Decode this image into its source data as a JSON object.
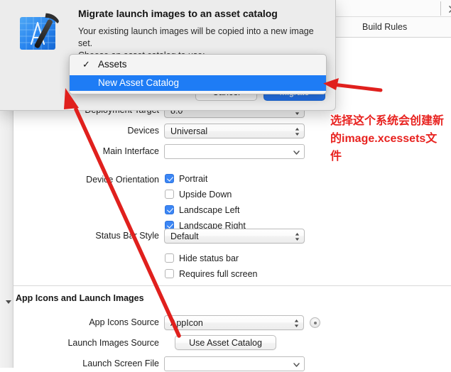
{
  "window": {
    "tabs": [
      {
        "id": "build-rules",
        "label": "Build Rules"
      }
    ],
    "chevron_icon": "chevron-right-icon"
  },
  "sheet": {
    "icon": "xcode-app-icon",
    "title": "Migrate launch images to an asset catalog",
    "body_line1": "Your existing launch images will be copied into a new image set.",
    "body_line2": "Choose an asset catalog to use:",
    "cancel_label": "Cancel",
    "migrate_label": "Migrate"
  },
  "menu": {
    "items": [
      {
        "label": "Assets",
        "checked": true,
        "selected": false
      },
      {
        "label": "New Asset Catalog",
        "checked": false,
        "selected": true
      }
    ],
    "check_glyph": "✓",
    "highlight_color": "#1e7cf5"
  },
  "form": {
    "deployment_target": {
      "label": "Deployment Target",
      "value": "8.0"
    },
    "devices": {
      "label": "Devices",
      "value": "Universal"
    },
    "main_interface": {
      "label": "Main Interface",
      "value": ""
    },
    "device_orientation": {
      "label": "Device Orientation",
      "options": [
        {
          "label": "Portrait",
          "checked": true
        },
        {
          "label": "Upside Down",
          "checked": false
        },
        {
          "label": "Landscape Left",
          "checked": true
        },
        {
          "label": "Landscape Right",
          "checked": true
        }
      ]
    },
    "status_bar_style": {
      "label": "Status Bar Style",
      "value": "Default"
    },
    "status_options": [
      {
        "label": "Hide status bar",
        "checked": false
      },
      {
        "label": "Requires full screen",
        "checked": false
      }
    ],
    "app_icons_section": {
      "header": "App Icons and Launch Images",
      "app_icons_source": {
        "label": "App Icons Source",
        "value": "AppIcon"
      },
      "launch_images_source": {
        "label": "Launch Images Source",
        "button_label": "Use Asset Catalog"
      },
      "launch_screen_file": {
        "label": "Launch Screen File",
        "value": ""
      }
    }
  },
  "annotation": {
    "text": "选择这个系统会创建新的image.xcessets文件",
    "color": "#e8221f"
  }
}
